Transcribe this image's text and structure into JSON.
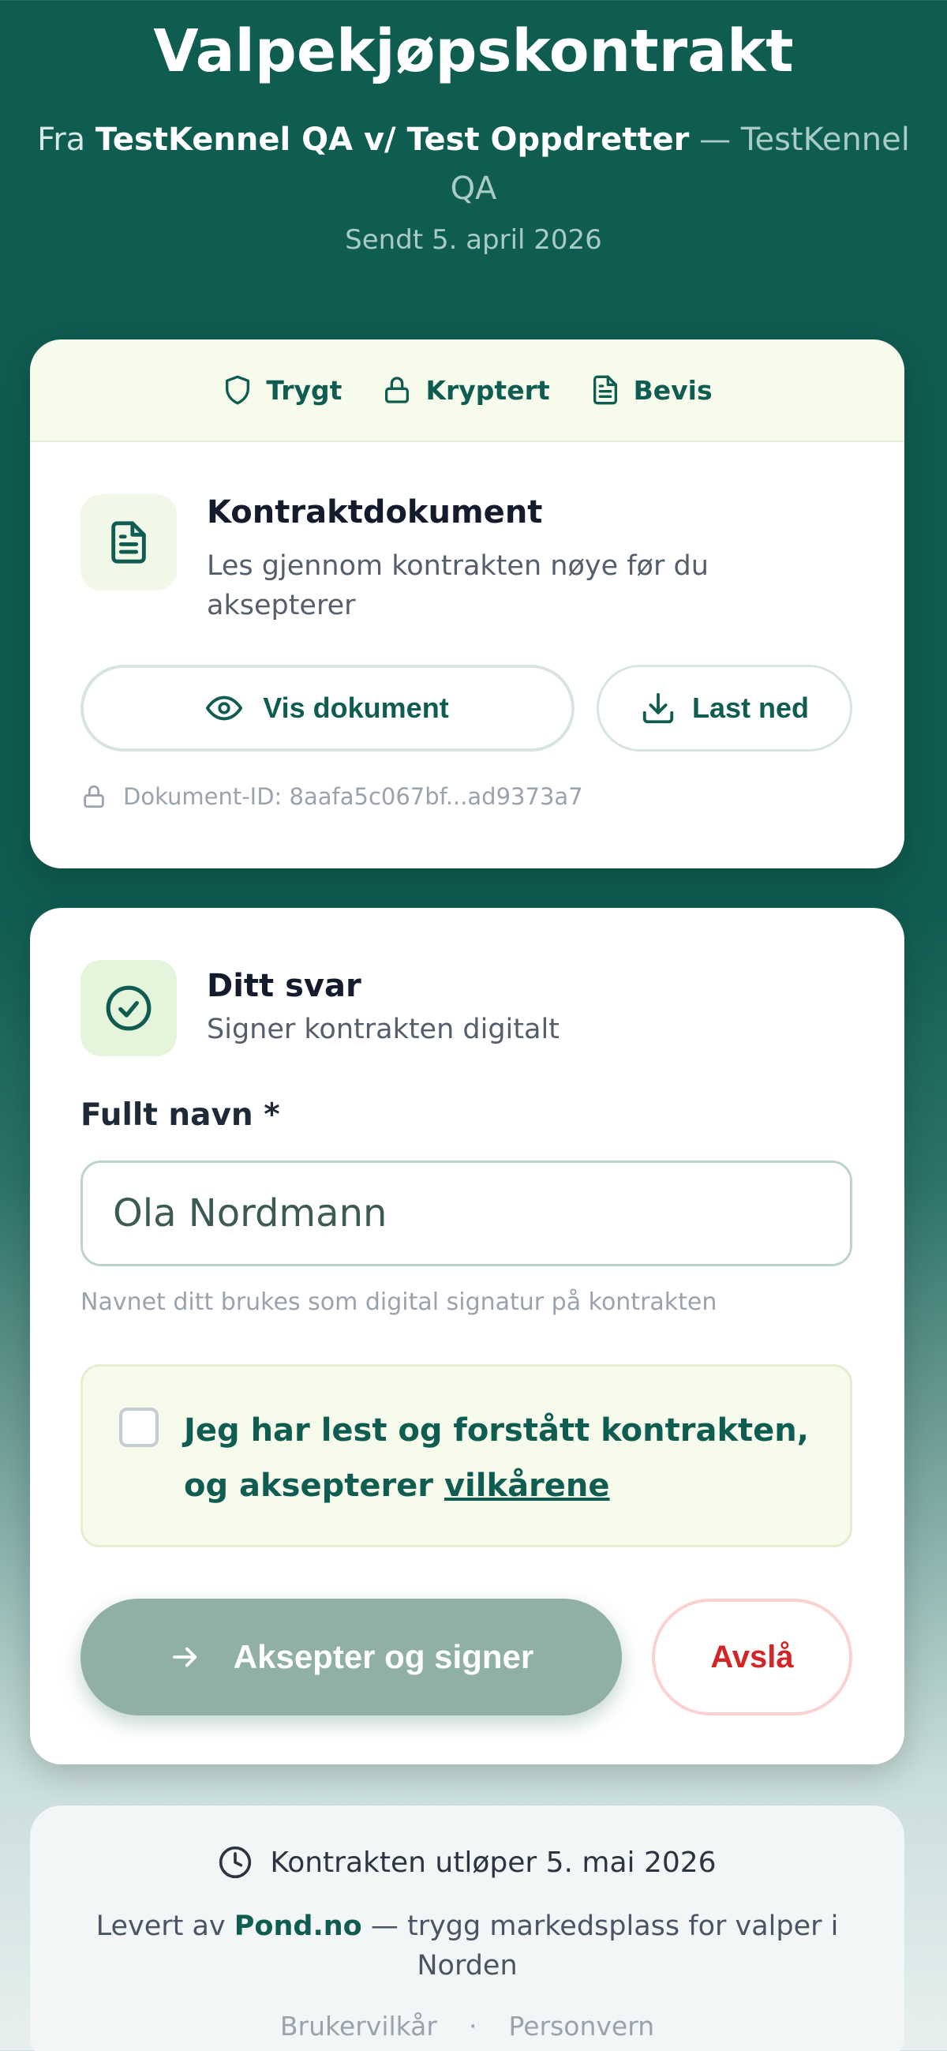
{
  "header": {
    "title": "Valpekjøpskontrakt",
    "from_prefix": "Fra",
    "sender_name": "TestKennel QA v/ Test Oppdretter",
    "separator": "—",
    "kennel_name": "TestKennel QA",
    "sent_date": "Sendt 5. april 2026"
  },
  "trust_bar": {
    "items": [
      {
        "label": "Trygt",
        "icon": "shield-icon"
      },
      {
        "label": "Kryptert",
        "icon": "lock-icon"
      },
      {
        "label": "Bevis",
        "icon": "document-icon"
      }
    ]
  },
  "document": {
    "title": "Kontraktdokument",
    "description": "Les gjennom kontrakten nøye før du aksepterer",
    "view_label": "Vis dokument",
    "download_label": "Last ned",
    "doc_id": "Dokument-ID: 8aafa5c067bf...ad9373a7"
  },
  "answer": {
    "title": "Ditt svar",
    "subtitle": "Signer kontrakten digitalt",
    "field_label": "Fullt navn *",
    "name_placeholder": "Ola Nordmann",
    "hint": "Navnet ditt brukes som digital signatur på kontrakten",
    "consent_text": "Jeg har lest og forstått kontrakten, og aksepterer ",
    "consent_link": "vilkårene",
    "accept_label": "Aksepter og signer",
    "decline_label": "Avslå"
  },
  "footer": {
    "expiry": "Kontrakten utløper 5. mai 2026",
    "provider_prefix": "Levert av ",
    "provider_brand": "Pond.no",
    "provider_suffix": " — trygg markedsplass for valper i Norden",
    "links": [
      "Brukervilkår",
      "·",
      "Personvern"
    ]
  },
  "colors": {
    "brand": "#0f5c51",
    "accent_bg": "#f6fbec",
    "decline": "#d32525",
    "accept_disabled": "#8fafa7"
  }
}
